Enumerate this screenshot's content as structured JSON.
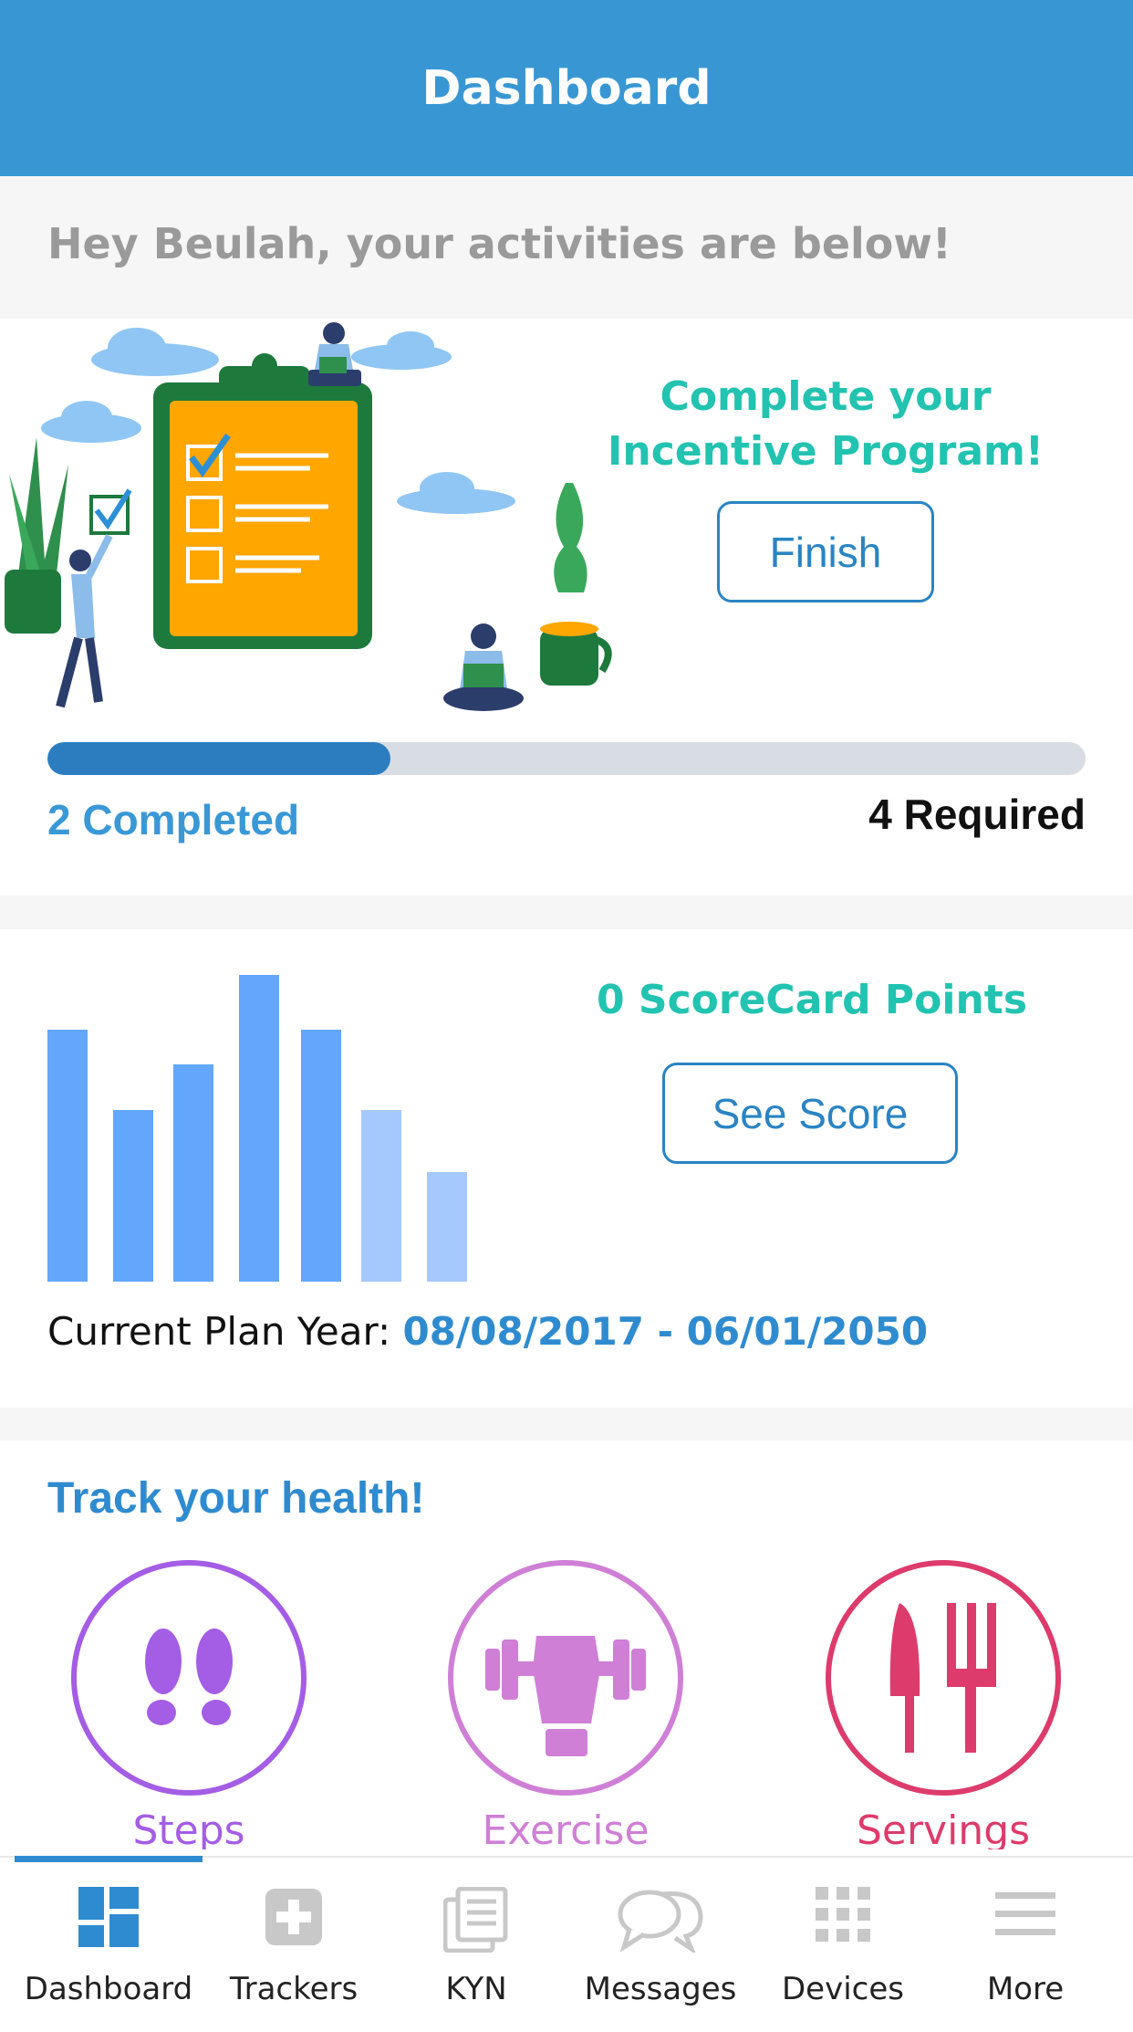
{
  "header": {
    "title": "Dashboard"
  },
  "greeting": "Hey Beulah, your activities are below!",
  "incentive": {
    "title_line1": "Complete your",
    "title_line2": "Incentive Program!",
    "finish_label": "Finish",
    "progress": {
      "completed": 2,
      "required": 4,
      "fraction": 0.33
    },
    "completed_label": "2 Completed",
    "required_label": "4 Required"
  },
  "scorecard": {
    "title": "0 ScoreCard Points",
    "see_score_label": "See Score",
    "plan_year_label": "Current Plan Year: ",
    "plan_year_dates": "08/08/2017 - 06/01/2050"
  },
  "track": {
    "title": "Track your health!",
    "items": [
      {
        "label": "Steps",
        "icon": "footprints-icon",
        "color": "#a45de5"
      },
      {
        "label": "Exercise",
        "icon": "dumbbell-fist-icon",
        "color": "#cf7fd6"
      },
      {
        "label": "Servings",
        "icon": "knife-fork-icon",
        "color": "#dd3b6c"
      }
    ]
  },
  "tabbar": {
    "active": "Dashboard",
    "tabs": [
      {
        "label": "Dashboard",
        "icon": "dashboard-icon"
      },
      {
        "label": "Trackers",
        "icon": "plus-box-icon"
      },
      {
        "label": "KYN",
        "icon": "news-icon"
      },
      {
        "label": "Messages",
        "icon": "chat-bubbles-icon"
      },
      {
        "label": "Devices",
        "icon": "grid-dots-icon"
      },
      {
        "label": "More",
        "icon": "menu-lines-icon"
      }
    ]
  },
  "colors": {
    "primary": "#3897d3",
    "accent_teal": "#22c3b0",
    "progress": "#2c7dc0"
  }
}
